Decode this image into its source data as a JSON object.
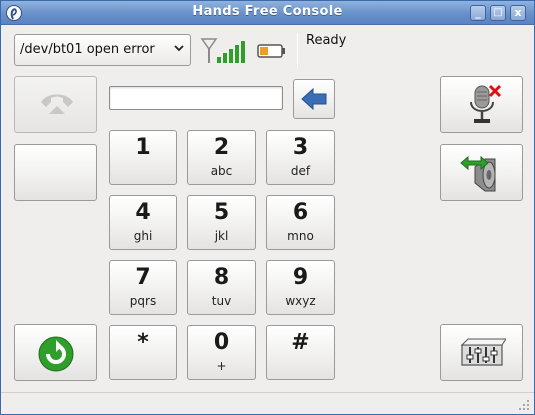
{
  "window": {
    "title": "Hands Free Console"
  },
  "window_controls": {
    "minimize": "_",
    "maximize": "□",
    "close": "x"
  },
  "device": {
    "selected": "/dev/bt01 open error"
  },
  "status": {
    "text": "Ready"
  },
  "indicators": {
    "signal_icon": "antenna-signal-icon",
    "battery_icon": "battery-low-icon"
  },
  "dialer": {
    "number_value": ""
  },
  "keys": [
    {
      "digit": "1",
      "letters": ""
    },
    {
      "digit": "2",
      "letters": "abc"
    },
    {
      "digit": "3",
      "letters": "def"
    },
    {
      "digit": "4",
      "letters": "ghi"
    },
    {
      "digit": "5",
      "letters": "jkl"
    },
    {
      "digit": "6",
      "letters": "mno"
    },
    {
      "digit": "7",
      "letters": "pqrs"
    },
    {
      "digit": "8",
      "letters": "tuv"
    },
    {
      "digit": "9",
      "letters": "wxyz"
    },
    {
      "digit": "*",
      "letters": ""
    },
    {
      "digit": "0",
      "letters": "+"
    },
    {
      "digit": "#",
      "letters": ""
    }
  ],
  "colors": {
    "titlebar": "#6890c9",
    "backspace_arrow": "#3a6fb8",
    "refresh_green": "#2f9e2a",
    "mute_x": "#d11"
  }
}
